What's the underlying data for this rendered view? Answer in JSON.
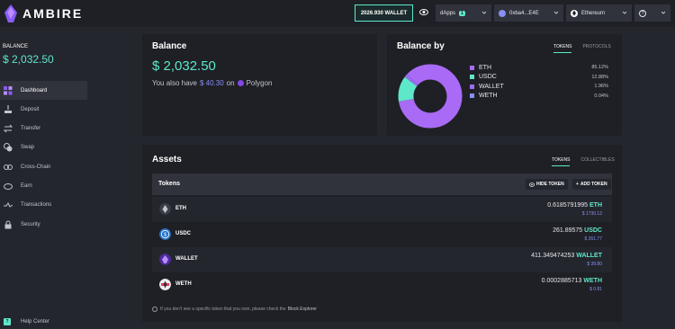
{
  "app": {
    "name": "AMBIRE"
  },
  "topbar": {
    "wallet_button": "2026.930 WALLET",
    "dapps_label": "dApps",
    "dapps_count": "1",
    "account": "0xba4...E4E",
    "network": "Ethereum"
  },
  "sidebar": {
    "balance_label": "BALANCE",
    "balance_int": "$ 2,032.",
    "balance_dec": "50",
    "items": [
      {
        "label": "Dashboard",
        "icon": "dashboard-icon",
        "active": true
      },
      {
        "label": "Deposit",
        "icon": "deposit-icon"
      },
      {
        "label": "Transfer",
        "icon": "transfer-icon"
      },
      {
        "label": "Swap",
        "icon": "swap-icon"
      },
      {
        "label": "Cross-Chain",
        "icon": "cross-chain-icon"
      },
      {
        "label": "Earn",
        "icon": "earn-icon"
      },
      {
        "label": "Transactions",
        "icon": "transactions-icon"
      },
      {
        "label": "Security",
        "icon": "lock-icon"
      }
    ],
    "help_center": "Help Center"
  },
  "balance_card": {
    "title": "Balance",
    "amount_int": "$ 2,032.",
    "amount_dec": "50",
    "also_prefix": "You also have",
    "also_amount_int": "$ 40.",
    "also_amount_dec": "30",
    "also_on": "on",
    "also_network": "Polygon"
  },
  "balance_by": {
    "title": "Balance by",
    "tabs": [
      "TOKENS",
      "PROTOCOLS"
    ],
    "legend": [
      {
        "name": "ETH",
        "pct": "85.12%",
        "value": 85.12,
        "color": "#a96bf5"
      },
      {
        "name": "USDC",
        "pct": "12.88%",
        "value": 12.88,
        "color": "#5ee8c9"
      },
      {
        "name": "WALLET",
        "pct": "1.96%",
        "value": 1.96,
        "color": "#9b6cf0"
      },
      {
        "name": "WETH",
        "pct": "0.04%",
        "value": 0.04,
        "color": "#8a8ff5"
      }
    ]
  },
  "assets": {
    "title": "Assets",
    "tabs": [
      "TOKENS",
      "COLLECTIBLES"
    ],
    "tokens_header": "Tokens",
    "hide_token": "HIDE TOKEN",
    "add_token": "ADD TOKEN",
    "tokens": [
      {
        "symbol": "ETH",
        "amount": "0.6185791995",
        "usd": "$ 1730.12",
        "icon": "eth-token-icon",
        "color": "#3a3d46"
      },
      {
        "symbol": "USDC",
        "amount": "261.89575",
        "usd": "$ 261.77",
        "icon": "usdc-token-icon",
        "color": "#2775ca"
      },
      {
        "symbol": "WALLET",
        "amount": "411.349474253",
        "usd": "$ 39.80",
        "icon": "wallet-token-icon",
        "color": "#6a3fc9"
      },
      {
        "symbol": "WETH",
        "amount": "0.0002885713",
        "usd": "$ 0.81",
        "icon": "weth-token-icon",
        "color": "#ececec"
      }
    ],
    "footnote": "If you don't see a specific token that you own, please check the",
    "footnote_link": "Block Explorer"
  }
}
